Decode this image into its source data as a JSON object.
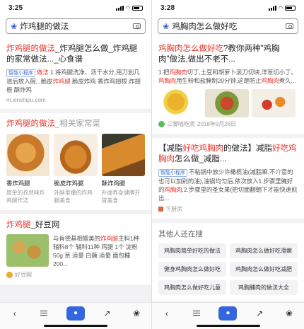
{
  "left": {
    "status": {
      "time": "3:25"
    },
    "search": {
      "query": "炸鸡腿的做法"
    },
    "result1": {
      "title_pre": "",
      "title_hl": "炸鸡腿的做法",
      "title_post": "_炸鸡腿怎么做_炸鸡腿的家常做法..._心食谱",
      "tag": "智能小程序",
      "abstract_hl": "做法",
      "abstract": " 1.将鸡腿洗净、沥干水分,用刀划几道后放入碗...脆皮",
      "abstract_hl2": "炸鸡腿",
      "abstract_tail": " 脆皮炸鸡 香炸鸡翅根 炸翅根 酥炸鸡",
      "source": "m.xinshipu.com"
    },
    "result2": {
      "title_hl": "炸鸡腿的做法",
      "title_dim": "_相关家常菜",
      "items": [
        {
          "name": "香炸鸡腿",
          "desc": "简单的孜然味炸鸡腿作法"
        },
        {
          "name": "脆皮炸鸡腿",
          "desc": "外酥里嫩的炸鸡腿美食"
        },
        {
          "name": "酥炸鸡腿",
          "desc": "补虚养身健脾开胃美食"
        }
      ]
    },
    "result3": {
      "title_hl": "炸鸡腿",
      "title_post": "_好豆网",
      "desc_pre": "与肯德基相媲美的",
      "desc_hl": "炸鸡腿",
      "desc_post": "主料1种 辅料8个 辅料11种 鸡腿 1个 淀粉 50g 葱 适量 白糖 适量 面包糠 200...",
      "source": "好豆网"
    }
  },
  "right": {
    "status": {
      "time": "3:28"
    },
    "search": {
      "query": "鸡胸肉怎么做好吃"
    },
    "result1": {
      "title_hl": "鸡胸肉怎么做好吃",
      "title_post": "?教你两种\"鸡胸肉\"做法,做出不老不...",
      "abstract": "1.把",
      "abstract_hl": "鸡胸肉",
      "abstract_mid": "切丁,土豆和胡萝卜滚刀切块,洋葱切小丁。",
      "abstract_hl2": "鸡胸肉",
      "abstract_tail": "用生粉和盐腌制20分钟,这是防止",
      "abstract_hl3": "鸡胸肉",
      "abstract_end": "煮久...",
      "source": "三脚喵吃货",
      "date": "2018年9月28日"
    },
    "result2": {
      "title_pre": "【减脂",
      "title_hl": "好吃鸡胸肉",
      "title_mid": "的做法】减脂",
      "title_hl2": "好吃鸡胸肉",
      "title_post": "怎么做_减脂...",
      "tag": "智能小程序",
      "abstract": "不粘锅中放少许橄榄油(减脂嘛,不介意的也可以加别的油),油锅均匀后,依次放入1.步骤里腌好的",
      "abstract_hl": "鸡胸肉",
      "abstract_tail": ",2.步骤里的圣女果(把切面翻朝下才能快速煎出...",
      "source": "下厨房"
    },
    "others": {
      "title": "其他人还在搜",
      "items": [
        "鸡胸肉简单好吃的做法",
        "鸡胸肉怎么做好吃滑嫩",
        "健身鸡胸肉怎么做好吃",
        "鸡胸肉怎么做好吃减肥",
        "鸡胸肉怎么做好吃儿童",
        "鸡胸脯肉的做法大全"
      ]
    }
  },
  "colors": {
    "highlight": "#e8352b",
    "accent": "#3466e0"
  },
  "icons": [
    "back-icon",
    "menu-icon",
    "mic-icon",
    "share-icon",
    "paw-icon"
  ]
}
